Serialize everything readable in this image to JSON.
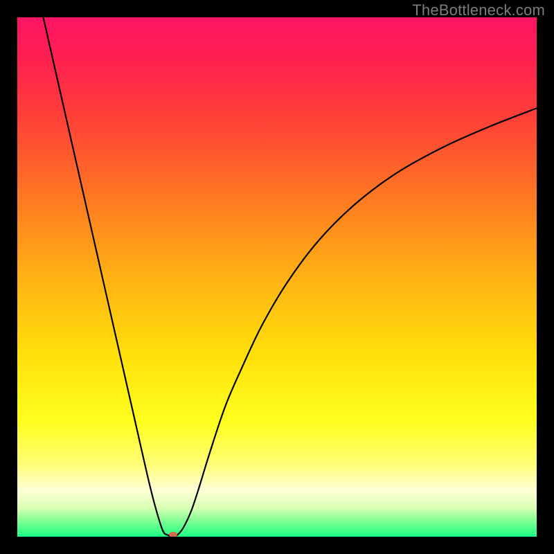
{
  "attribution": "TheBottleneck.com",
  "chart_data": {
    "type": "line",
    "title": "",
    "xlabel": "",
    "ylabel": "",
    "xlim": [
      0,
      100
    ],
    "ylim": [
      0,
      100
    ],
    "grid": false,
    "legend": false,
    "background_gradient": {
      "stops": [
        {
          "pos": 0.0,
          "color": "#ff1464"
        },
        {
          "pos": 0.08,
          "color": "#ff2050"
        },
        {
          "pos": 0.2,
          "color": "#ff4236"
        },
        {
          "pos": 0.35,
          "color": "#ff7a22"
        },
        {
          "pos": 0.5,
          "color": "#ffb114"
        },
        {
          "pos": 0.65,
          "color": "#ffe00a"
        },
        {
          "pos": 0.78,
          "color": "#ffff20"
        },
        {
          "pos": 0.86,
          "color": "#fffe76"
        },
        {
          "pos": 0.91,
          "color": "#ffffd6"
        },
        {
          "pos": 0.945,
          "color": "#d8ffb4"
        },
        {
          "pos": 0.97,
          "color": "#7fff93"
        },
        {
          "pos": 1.0,
          "color": "#1cff85"
        }
      ]
    },
    "series": [
      {
        "name": "bottleneck-curve",
        "color": "#000000",
        "x": [
          5.0,
          7.0,
          9.0,
          11.0,
          13.0,
          15.0,
          17.0,
          19.0,
          21.0,
          23.0,
          25.0,
          26.5,
          28.0,
          29.0,
          30.0,
          31.0,
          32.0,
          33.5,
          35.0,
          37.0,
          40.0,
          43.0,
          47.0,
          52.0,
          58.0,
          65.0,
          73.0,
          82.0,
          91.0,
          100.0
        ],
        "y": [
          100.0,
          91.2,
          82.4,
          73.6,
          64.8,
          56.0,
          47.2,
          38.4,
          29.6,
          20.8,
          12.0,
          6.0,
          1.2,
          0.3,
          0.0,
          0.5,
          1.8,
          5.0,
          9.5,
          16.0,
          25.0,
          32.0,
          40.5,
          49.0,
          57.0,
          64.0,
          70.0,
          75.0,
          79.0,
          82.5
        ]
      }
    ],
    "markers": [
      {
        "name": "optimum-marker",
        "x": 30.0,
        "y": 0.4,
        "color": "#d36a4a",
        "rx": 6,
        "ry": 4
      }
    ]
  }
}
